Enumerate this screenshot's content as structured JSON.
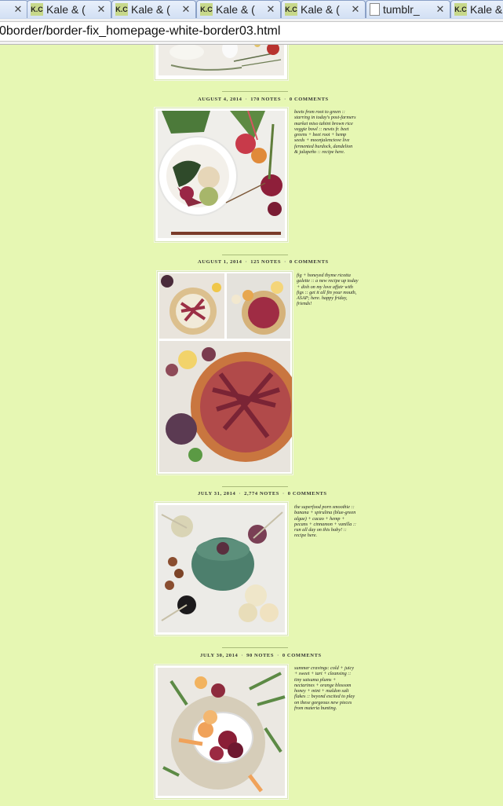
{
  "browser": {
    "tabs": [
      {
        "title": "",
        "favicon": ""
      },
      {
        "title": "Kale & (",
        "favicon": "K.C"
      },
      {
        "title": "Kale & (",
        "favicon": "K.C"
      },
      {
        "title": "Kale & (",
        "favicon": "K.C"
      },
      {
        "title": "Kale & (",
        "favicon": "K.C"
      },
      {
        "title": "tumblr_",
        "favicon": ""
      },
      {
        "title": "Kale &",
        "favicon": "K.C"
      }
    ],
    "url": "0border/border-fix_homepage-white-border03.html"
  },
  "posts": [
    {
      "date": "AUGUST 4, 2014",
      "notes": "170 NOTES",
      "comments": "0 COMMENTS",
      "caption": "beets from root to green :: starring in today's post-farmers market miso tahini brown rice veggie bowl :: newts fr. beet greens + beet root + hemp seeds + moonjalenciove live fermented burdock, dandelion & jalapeño :: recipe here."
    },
    {
      "date": "AUGUST 1, 2014",
      "notes": "125 NOTES",
      "comments": "0 COMMENTS",
      "caption": "fig + honeyed thyme ricotta galette :: a new recipe up today + dish on my love affair with figs :: get it all fin your mouth, ASAP; here. happy friday, friends!"
    },
    {
      "date": "JULY 31, 2014",
      "notes": "2,774 NOTES",
      "comments": "0 COMMENTS",
      "caption": "the superfood porn smoothie :: banana + spirulina (blue-green algae) + cacao + hemp + pecans + cinnamon + vanilla :: run all day on this baby! :: recipe here."
    },
    {
      "date": "JULY 30, 2014",
      "notes": "90 NOTES",
      "comments": "0 COMMENTS",
      "caption": "summer cravings: cold + juicy + sweet + tart + cleansing :: tiny satsuma plums + nectarines + orange blossom honey + mint + maldon salt flakes :: beyond excited to play on these gorgeous new pieces from materia bunting."
    }
  ],
  "colors": {
    "page_background": "#e6f7b3",
    "separator": "#a9bb7a"
  }
}
